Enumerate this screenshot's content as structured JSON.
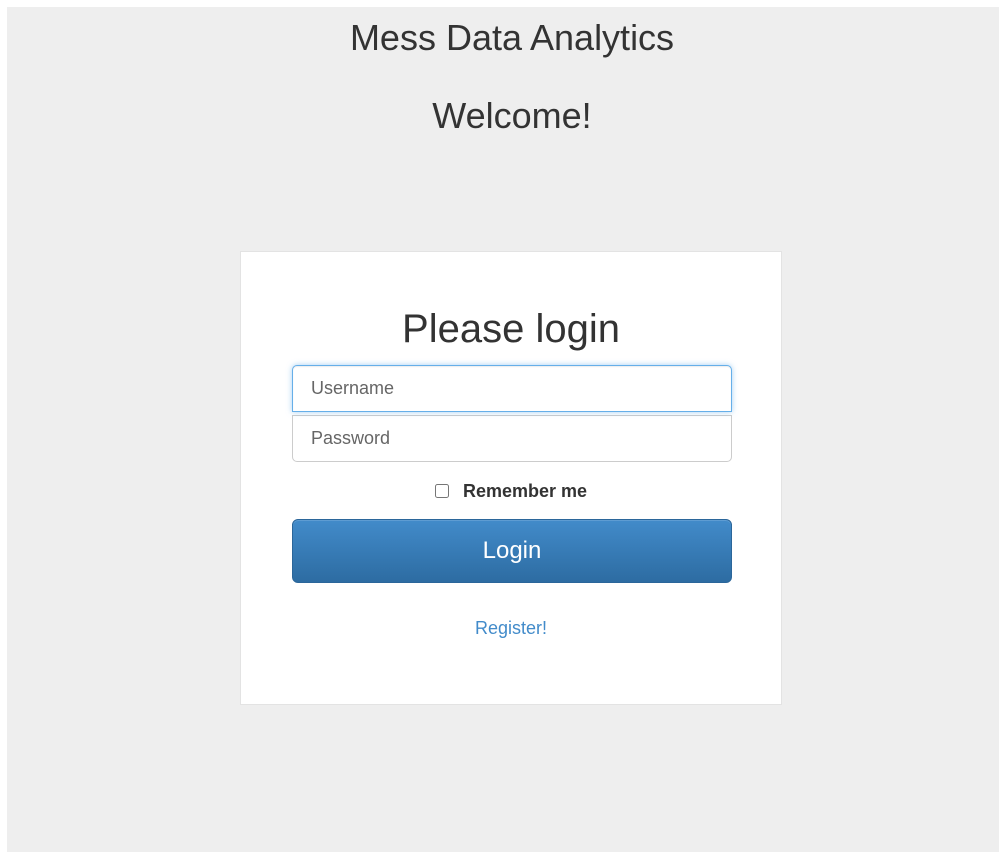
{
  "header": {
    "app_title": "Mess Data Analytics",
    "welcome": "Welcome!"
  },
  "login_form": {
    "title": "Please login",
    "username": {
      "value": "",
      "placeholder": "Username"
    },
    "password": {
      "value": "",
      "placeholder": "Password"
    },
    "remember_me": {
      "label": "Remember me",
      "checked": false
    },
    "login_button_label": "Login",
    "register_link_label": "Register!"
  },
  "colors": {
    "page_background": "#eeeeee",
    "card_background": "#ffffff",
    "primary": "#428bca",
    "primary_dark": "#2d6ca2",
    "focus_border": "#66afe9",
    "text": "#333333"
  }
}
